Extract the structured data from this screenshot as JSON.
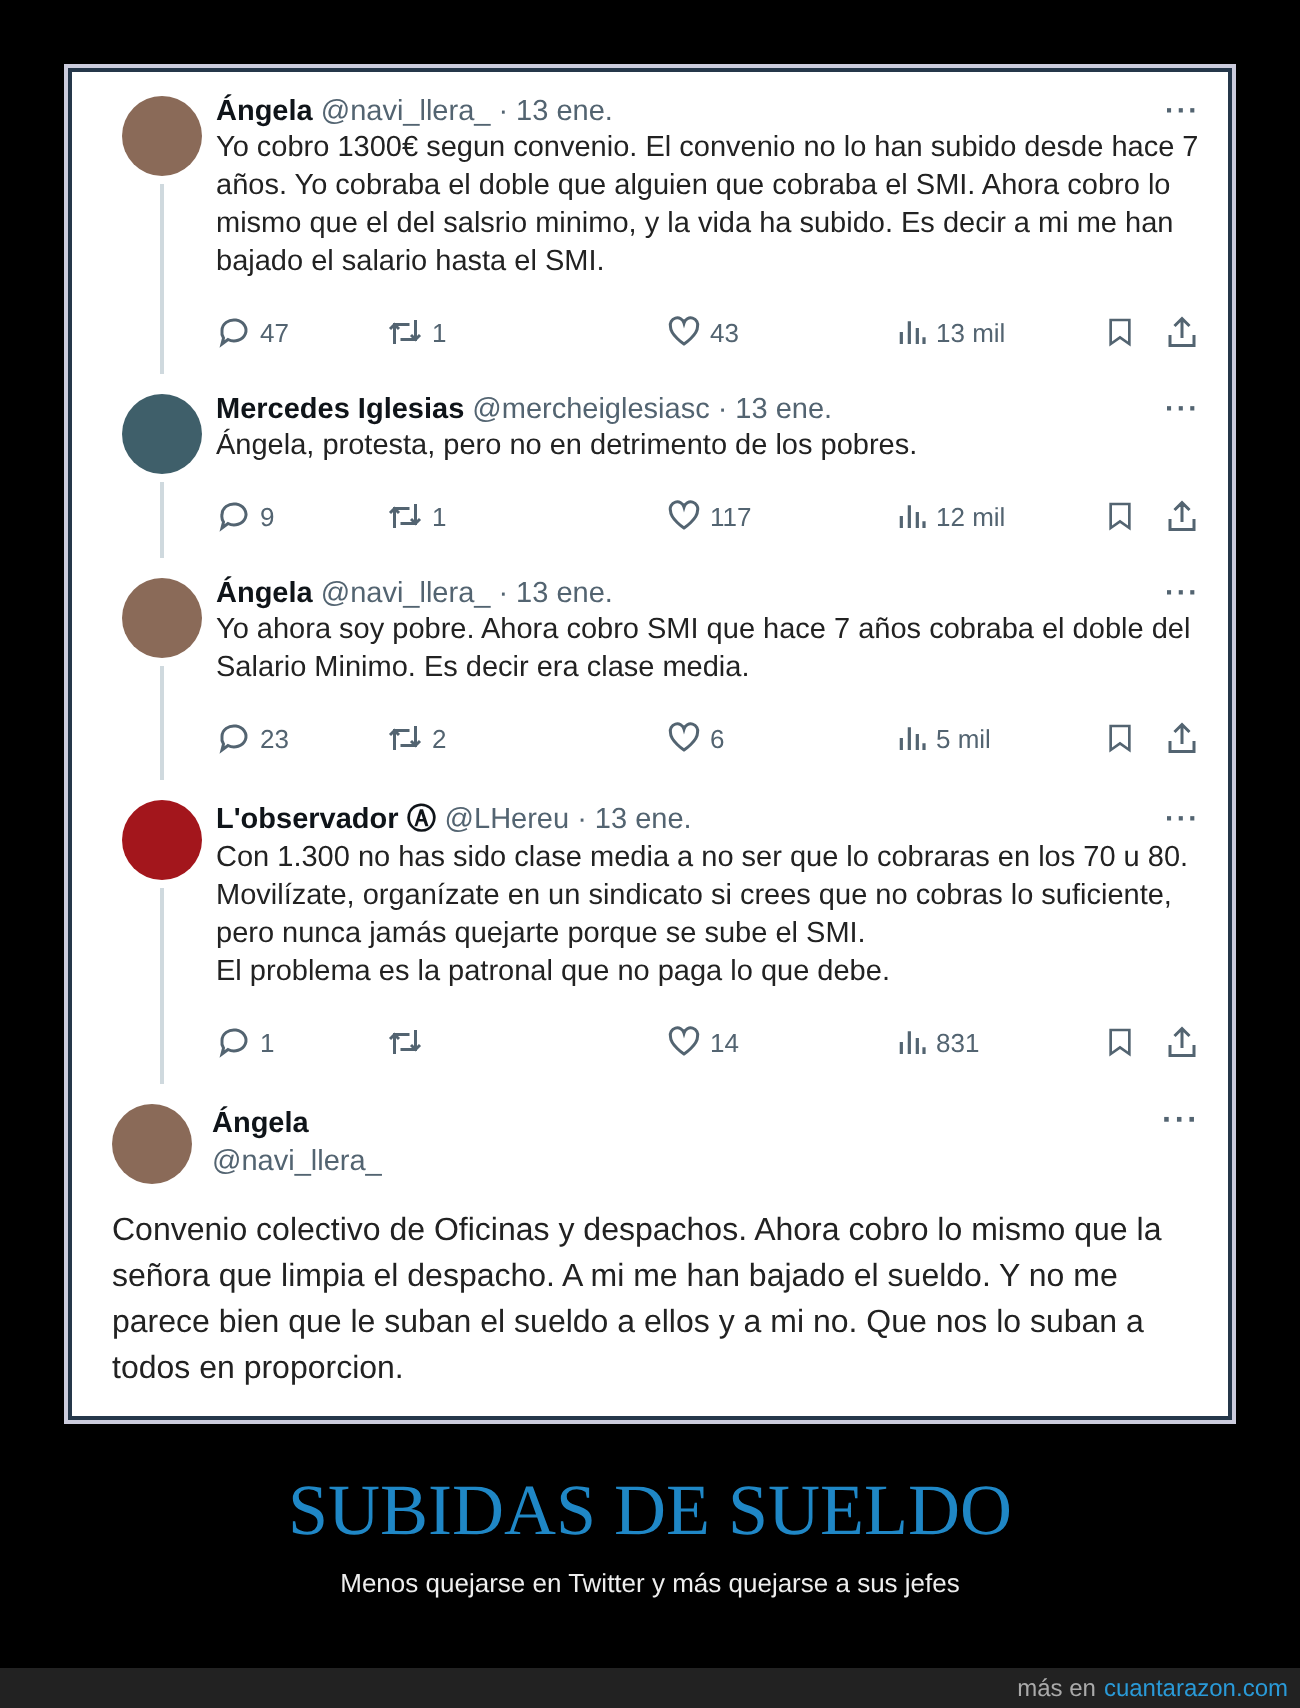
{
  "tweets": [
    {
      "kind": "reply",
      "color": "#8a6a58",
      "name": "Ángela",
      "handle": "@navi_llera_",
      "date": "· 13 ene.",
      "menu": "···",
      "text": "Yo cobro 1300€ segun convenio. El convenio no lo han subido desde hace 7 años. Yo cobraba el doble que alguien que cobraba el SMI. Ahora cobro lo mismo que el del salsrio minimo, y la vida ha subido. Es decir a mi me han bajado el salario hasta el SMI.",
      "replies": "47",
      "retweets": "1",
      "likes": "43",
      "views": "13 mil"
    },
    {
      "kind": "reply",
      "color": "#3f5f6a",
      "name": "Mercedes Iglesias",
      "handle": "@mercheiglesiasc",
      "date": "· 13 ene.",
      "menu": "···",
      "text": "Ángela, protesta, pero no en detrimento de los pobres.",
      "replies": "9",
      "retweets": "1",
      "likes": "117",
      "views": "12 mil"
    },
    {
      "kind": "reply",
      "color": "#8a6a58",
      "name": "Ángela",
      "handle": "@navi_llera_",
      "date": "· 13 ene.",
      "menu": "···",
      "text": "Yo ahora soy pobre. Ahora cobro SMI que hace 7 años cobraba el doble del Salario Minimo. Es decir era clase media.",
      "replies": "23",
      "retweets": "2",
      "likes": "6",
      "views": "5 mil"
    },
    {
      "kind": "reply",
      "color": "#a3161c",
      "name": "L'observador",
      "badge": "Ⓐ",
      "handle": "@LHereu",
      "date": "· 13 ene.",
      "menu": "···",
      "text": "Con 1.300 no has sido clase media a no ser que lo cobraras en los 70 u 80.\nMovilízate, organízate en un sindicato si crees que no cobras lo suficiente, pero nunca jamás quejarte porque se sube el SMI.\nEl problema es la patronal que no paga lo que debe.",
      "replies": "1",
      "likes": "14",
      "views": "831"
    },
    {
      "kind": "main",
      "color": "#8a6a58",
      "name": "Ángela",
      "handle": "@navi_llera_",
      "menu": "···",
      "text": "Convenio colectivo de Oficinas y despachos. Ahora cobro lo mismo que la señora que limpia el despacho. A mi me han bajado el sueldo. Y no me parece bien que le suban el sueldo a ellos y a mi no. Que nos lo suban a todos en proporcion."
    }
  ],
  "caption": {
    "title": "SUBIDAS DE SUELDO",
    "subtitle": "Menos quejarse en Twitter y más quejarse a sus jefes"
  },
  "footer": {
    "prefix": "más en",
    "link": "cuantarazon.com"
  }
}
